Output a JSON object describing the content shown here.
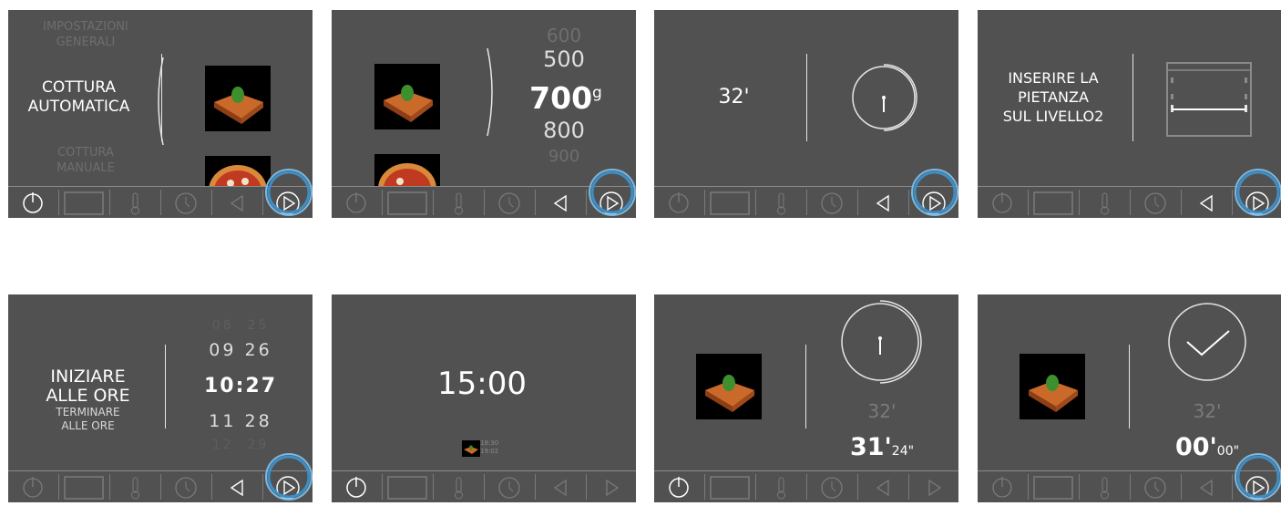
{
  "panels": {
    "p1": {
      "top_label": "IMPOSTAZIONI\nGENERALI",
      "mode_label": "COTTURA\nAUTOMATICA",
      "bottom_label": "COTTURA\nMANUALE",
      "dish_icon": "lasagna-icon",
      "next_dish_icon": "pizza-icon"
    },
    "p2": {
      "w600": "600",
      "w500": "500",
      "w700": "700",
      "unit": "g",
      "w800": "800",
      "w900": "900",
      "dish_icon": "lasagna-icon"
    },
    "p3": {
      "time": "32'"
    },
    "p4": {
      "instruction": "INSERIRE LA\nPIETANZA\nSUL LIVELLO2"
    },
    "p5": {
      "start_label": "INIZIARE\nALLE ORE",
      "end_label": "TERMINARE\nALLE ORE",
      "row_prev_h": "09",
      "row_prev_m": "26",
      "row_sel_h": "10",
      "row_sel_sep": ":",
      "row_sel_m": "27",
      "row_next_h": "11",
      "row_next_m": "28",
      "row_top_h": "08",
      "row_top_m": "25",
      "row_bot_h": "12",
      "row_bot_m": "29"
    },
    "p6": {
      "clock": "15:00",
      "start_time": "18:30",
      "end_time": "19:02"
    },
    "p7": {
      "total": "32'",
      "remaining_min": "31'",
      "remaining_sec": "24\""
    },
    "p8": {
      "total": "32'",
      "remaining_min": "00'",
      "remaining_sec": "00\""
    }
  },
  "toolbar": {
    "icons": [
      "power-icon",
      "oven-icon",
      "thermometer-icon",
      "clock-icon",
      "back-arrow-icon",
      "forward-arrow-icon"
    ]
  },
  "colors": {
    "screen": "#515151",
    "text": "#ffffff",
    "dim_text": "#6e6e6e",
    "highlight_ring": "#5aa6d6"
  }
}
